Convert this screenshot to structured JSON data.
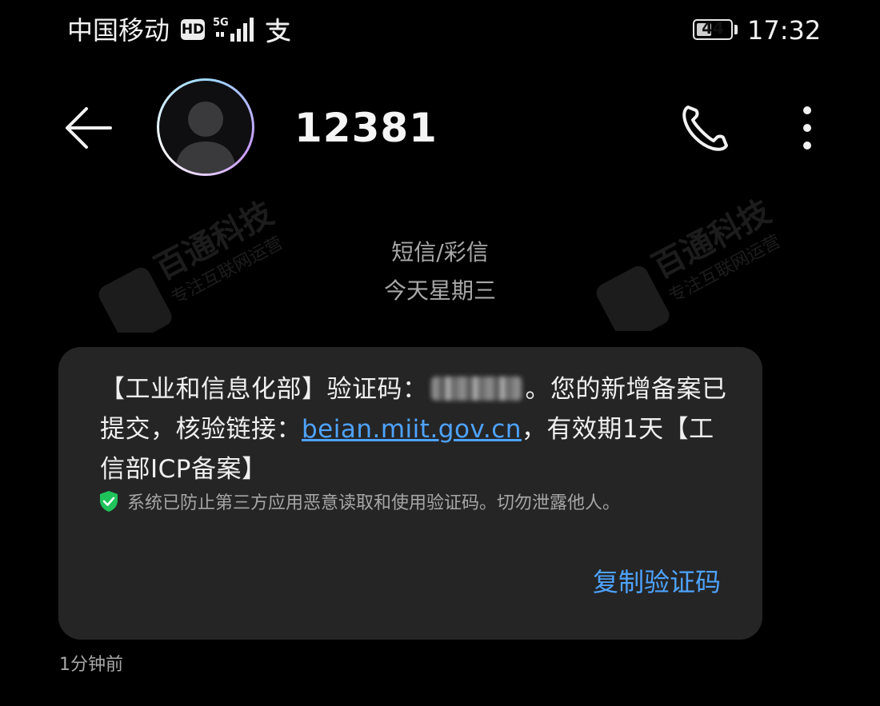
{
  "status_bar": {
    "carrier": "中国移动",
    "hd_badge": "HD",
    "network": "5G",
    "battery_level": "44",
    "battery_fraction": 0.44,
    "time": "17:32"
  },
  "header": {
    "contact_name": "12381"
  },
  "watermark": {
    "brand": "百通科技",
    "slogan": "专注互联网运营"
  },
  "conversation": {
    "message_type": "短信/彩信",
    "day_label": "今天星期三"
  },
  "message": {
    "prefix": "【工业和信息化部】验证码：",
    "after_code": "。您的新增备案已提交，核验链接：",
    "link": "beian.miit.gov.cn",
    "suffix": "，有效期1天【工信部ICP备案】",
    "security_note": "系统已防止第三方应用恶意读取和使用验证码。切勿泄露他人。",
    "copy_action": "复制验证码",
    "timestamp": "1分钟前"
  },
  "colors": {
    "background": "#000000",
    "bubble": "#252526",
    "accent": "#4ea3ff",
    "secure_green": "#1fc35a"
  },
  "icons": {
    "back": "arrow-left-icon",
    "call": "phone-icon",
    "more": "more-vertical-icon",
    "avatar": "person-icon",
    "security": "shield-check-icon"
  }
}
